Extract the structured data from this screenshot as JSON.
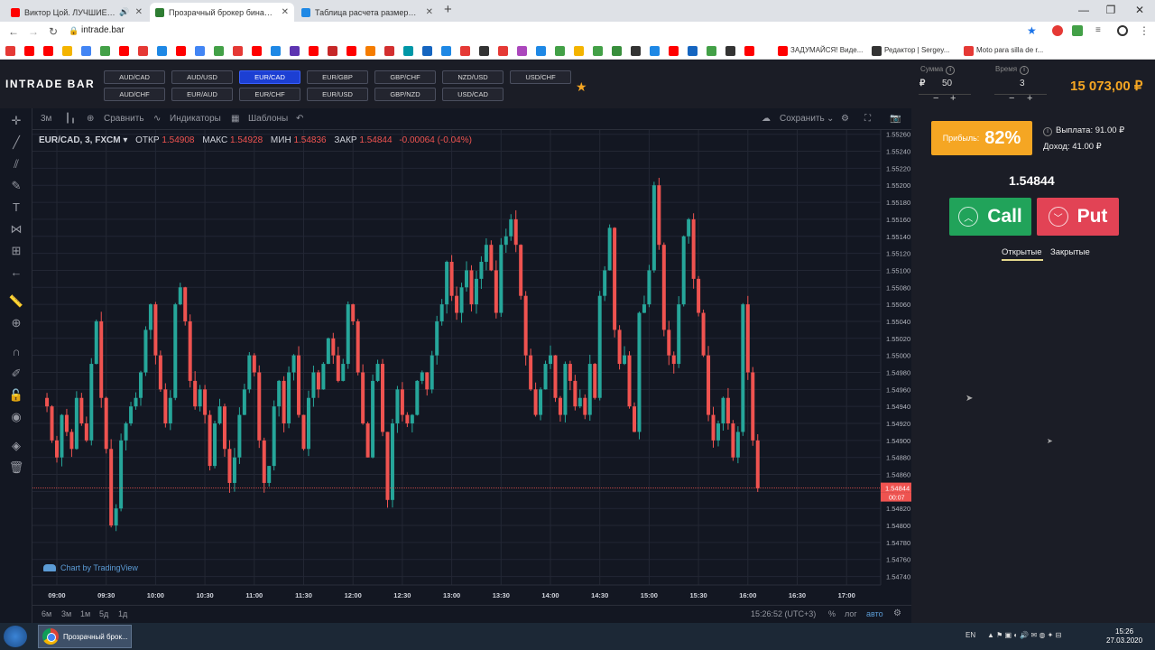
{
  "browser": {
    "tabs": [
      {
        "title": "Виктор Цой. ЛУЧШИЕ ПЕСНИ",
        "color": "#ff0000",
        "active": false
      },
      {
        "title": "Прозрачный брокер бинарных...",
        "color": "#2e7d32",
        "active": true
      },
      {
        "title": "Таблица расчета размера сделк...",
        "color": "#1e88e5",
        "active": false
      }
    ],
    "url": "intrade.bar",
    "bookmark_labels": [
      "ЗАДУМАЙСЯ! Виде...",
      "Редактор | Sergey...",
      "Moto para silla de r..."
    ]
  },
  "app": {
    "logo": "INTRADE BAR",
    "pairs_row1": [
      "AUD/CAD",
      "AUD/USD",
      "EUR/CAD",
      "EUR/GBP",
      "GBP/CHF",
      "NZD/USD",
      "USD/CHF"
    ],
    "pairs_row2": [
      "AUD/CHF",
      "EUR/AUD",
      "EUR/CHF",
      "EUR/USD",
      "GBP/NZD",
      "USD/CAD"
    ],
    "active_pair": "EUR/CAD",
    "sum_label": "Сумма",
    "sum_currency": "₽",
    "sum_value": "50",
    "time_label": "Время",
    "time_value": "3",
    "minus": "−",
    "plus": "+",
    "info": "i",
    "balance": "15 073,00 ₽"
  },
  "chart_toolbar": {
    "interval": "3м",
    "compare": "Сравнить",
    "indicators": "Индикаторы",
    "templates": "Шаблоны",
    "save": "Сохранить"
  },
  "legend": {
    "symbol": "EUR/CAD, 3, FXCM",
    "open_label": "ОТКР",
    "open": "1.54908",
    "high_label": "МАКС",
    "high": "1.54928",
    "low_label": "МИН",
    "low": "1.54836",
    "close_label": "ЗАКР",
    "close": "1.54844",
    "change": "-0.00064 (-0.04%)"
  },
  "tradingview": "Chart by TradingView",
  "bottom_bar": {
    "ranges": [
      "6м",
      "3м",
      "1м",
      "5д",
      "1д"
    ],
    "time": "15:26:52 (UTC+3)",
    "percent": "%",
    "log": "лог",
    "auto": "авто"
  },
  "chart_data": {
    "type": "candlestick",
    "x_ticks": [
      "09:00",
      "09:30",
      "10:00",
      "10:30",
      "11:00",
      "11:30",
      "12:00",
      "12:30",
      "13:00",
      "13:30",
      "14:00",
      "14:30",
      "15:00",
      "15:30",
      "16:00",
      "16:30",
      "17:00"
    ],
    "y_ticks": [
      "1.55260",
      "1.55240",
      "1.55220",
      "1.55200",
      "1.55180",
      "1.55160",
      "1.55140",
      "1.55120",
      "1.55100",
      "1.55080",
      "1.55060",
      "1.55040",
      "1.55020",
      "1.55000",
      "1.54980",
      "1.54960",
      "1.54940",
      "1.54920",
      "1.54900",
      "1.54880",
      "1.54860",
      "1.54840",
      "1.54820",
      "1.54800",
      "1.54780",
      "1.54760",
      "1.54740"
    ],
    "ylim": [
      1.5473,
      1.55265
    ],
    "last_price": "1.54844",
    "countdown": "00:07",
    "up_color": "#26a69a",
    "down_color": "#ef5350",
    "candle_interval_min": 3,
    "start_time": "08:54",
    "closes": [
      1.5494,
      1.549,
      1.5488,
      1.5493,
      1.5491,
      1.5489,
      1.5495,
      1.5492,
      1.549,
      1.5499,
      1.5504,
      1.5495,
      1.5489,
      1.548,
      1.5482,
      1.549,
      1.5492,
      1.5494,
      1.5495,
      1.5498,
      1.5503,
      1.5506,
      1.55,
      1.5496,
      1.5492,
      1.5495,
      1.5506,
      1.5508,
      1.5504,
      1.5497,
      1.5494,
      1.5496,
      1.5493,
      1.5487,
      1.5492,
      1.5494,
      1.5489,
      1.5485,
      1.5488,
      1.5493,
      1.5496,
      1.55,
      1.5498,
      1.549,
      1.5485,
      1.5487,
      1.5494,
      1.5497,
      1.5492,
      1.5498,
      1.55,
      1.5493,
      1.5489,
      1.5495,
      1.5498,
      1.5496,
      1.5499,
      1.5502,
      1.55,
      1.5497,
      1.5499,
      1.5506,
      1.5504,
      1.5498,
      1.5492,
      1.5488,
      1.5497,
      1.5499,
      1.5491,
      1.5483,
      1.5492,
      1.5496,
      1.5493,
      1.5492,
      1.5493,
      1.5497,
      1.5498,
      1.5496,
      1.55,
      1.5504,
      1.5506,
      1.5511,
      1.5507,
      1.5505,
      1.5508,
      1.551,
      1.5506,
      1.5509,
      1.5511,
      1.5513,
      1.551,
      1.5505,
      1.5513,
      1.5514,
      1.5516,
      1.5513,
      1.5507,
      1.55,
      1.5496,
      1.5493,
      1.5496,
      1.5499,
      1.55,
      1.5495,
      1.5493,
      1.5499,
      1.5497,
      1.5494,
      1.5495,
      1.5493,
      1.5499,
      1.5495,
      1.5507,
      1.551,
      1.5515,
      1.5503,
      1.5499,
      1.55,
      1.5494,
      1.5491,
      1.5505,
      1.5506,
      1.551,
      1.552,
      1.5513,
      1.5503,
      1.55,
      1.5499,
      1.5506,
      1.5514,
      1.5516,
      1.5509,
      1.5505,
      1.55,
      1.5493,
      1.549,
      1.5492,
      1.5495,
      1.5492,
      1.5488,
      1.5491,
      1.5506,
      1.5498,
      1.549,
      1.54844
    ]
  },
  "trade_panel": {
    "profit_label": "Прибыль:",
    "profit_value": "82%",
    "payout": "Выплата: 91.00 ₽",
    "income": "Доход: 41.00 ₽",
    "price": "1.54844",
    "call": "Call",
    "put": "Put",
    "tab_open": "Открытые",
    "tab_closed": "Закрытые"
  },
  "taskbar": {
    "app_title": "Прозрачный брок...",
    "lang": "EN",
    "time": "15:26",
    "date": "27.03.2020"
  }
}
